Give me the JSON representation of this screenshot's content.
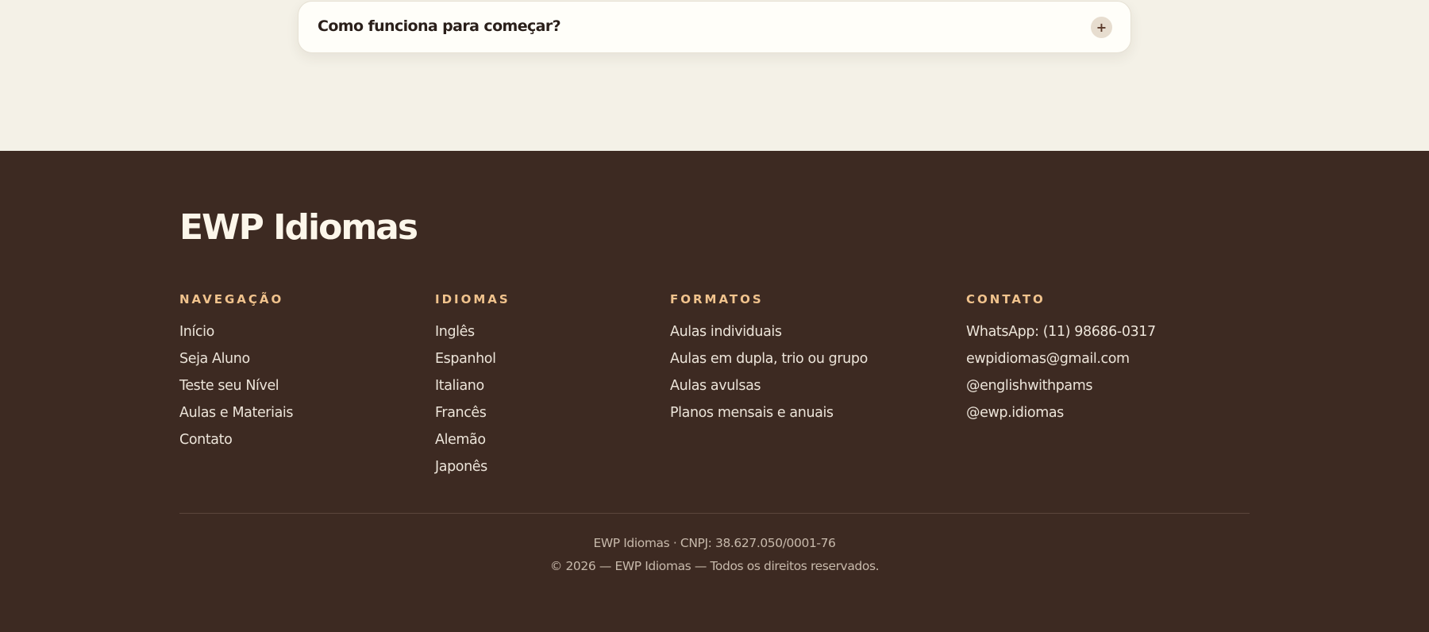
{
  "faq": {
    "question": "Como funciona para começar?",
    "toggle_symbol": "+"
  },
  "footer": {
    "brand": "EWP Idiomas",
    "columns": {
      "navigation": {
        "heading": "NAVEGAÇÃO",
        "items": [
          "Início",
          "Seja Aluno",
          "Teste seu Nível",
          "Aulas e Materiais",
          "Contato"
        ]
      },
      "languages": {
        "heading": "IDIOMAS",
        "items": [
          "Inglês",
          "Espanhol",
          "Italiano",
          "Francês",
          "Alemão",
          "Japonês"
        ]
      },
      "formats": {
        "heading": "FORMATOS",
        "items": [
          "Aulas individuais",
          "Aulas em dupla, trio ou grupo",
          "Aulas avulsas",
          "Planos mensais e anuais"
        ]
      },
      "contact": {
        "heading": "CONTATO",
        "items": [
          "WhatsApp: (11) 98686-0317",
          "ewpidiomas@gmail.com",
          "@englishwithpams",
          "@ewp.idiomas"
        ]
      }
    },
    "legal_line": "EWP Idiomas · CNPJ: 38.627.050/0001-76",
    "copyright": "© 2026 — EWP Idiomas — Todos os direitos reservados."
  },
  "colors": {
    "page_background": "#f4f1e7",
    "footer_background": "#3d2a22",
    "heading_accent": "#f1c38d",
    "brand_text": "#fcf6ea"
  }
}
